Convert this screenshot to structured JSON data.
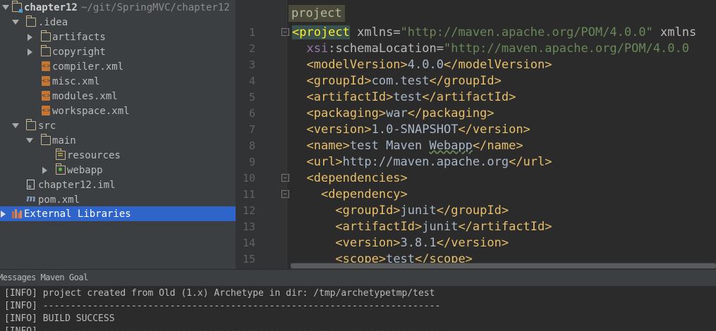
{
  "project_tree": {
    "root": {
      "name": "chapter12",
      "path": "~/git/SpringMVC/chapter12"
    },
    "items": [
      {
        "label": ".idea"
      },
      {
        "label": "artifacts"
      },
      {
        "label": "copyright"
      },
      {
        "label": "compiler.xml"
      },
      {
        "label": "misc.xml"
      },
      {
        "label": "modules.xml"
      },
      {
        "label": "workspace.xml"
      },
      {
        "label": "src"
      },
      {
        "label": "main"
      },
      {
        "label": "resources"
      },
      {
        "label": "webapp"
      },
      {
        "label": "chapter12.iml"
      },
      {
        "label": "pom.xml"
      },
      {
        "label": "External Libraries"
      }
    ],
    "maven_icon_glyph": "m"
  },
  "editor": {
    "breadcrumb": "project",
    "line_numbers": [
      "1",
      "2",
      "3",
      "4",
      "5",
      "6",
      "7",
      "8",
      "9",
      "10",
      "11",
      "12",
      "13",
      "14",
      "15"
    ],
    "lines": [
      [
        {
          "t": "<project",
          "c": "hl"
        },
        {
          "t": " xmlns",
          "c": "attr"
        },
        {
          "t": "=",
          "c": "attr"
        },
        {
          "t": "\"http://maven.apache.org/POM/4.0.0\"",
          "c": "val"
        },
        {
          "t": " xmlns",
          "c": "attr"
        }
      ],
      [
        {
          "t": "  "
        },
        {
          "t": "xsi",
          "c": "ns"
        },
        {
          "t": ":schemaLocation",
          "c": "attr"
        },
        {
          "t": "=",
          "c": "attr"
        },
        {
          "t": "\"http://maven.apache.org/POM/4.0.0",
          "c": "val"
        }
      ],
      [
        {
          "t": "  "
        },
        {
          "t": "<modelVersion>",
          "c": "tag"
        },
        {
          "t": "4.0.0",
          "c": "txt"
        },
        {
          "t": "</modelVersion>",
          "c": "tag"
        }
      ],
      [
        {
          "t": "  "
        },
        {
          "t": "<groupId>",
          "c": "tag"
        },
        {
          "t": "com.test",
          "c": "txt"
        },
        {
          "t": "</groupId>",
          "c": "tag"
        }
      ],
      [
        {
          "t": "  "
        },
        {
          "t": "<artifactId>",
          "c": "tag"
        },
        {
          "t": "test",
          "c": "txt"
        },
        {
          "t": "</artifactId>",
          "c": "tag"
        }
      ],
      [
        {
          "t": "  "
        },
        {
          "t": "<packaging>",
          "c": "tag"
        },
        {
          "t": "war",
          "c": "txt"
        },
        {
          "t": "</packaging>",
          "c": "tag"
        }
      ],
      [
        {
          "t": "  "
        },
        {
          "t": "<version>",
          "c": "tag"
        },
        {
          "t": "1.0-SNAPSHOT",
          "c": "txt"
        },
        {
          "t": "</version>",
          "c": "tag"
        }
      ],
      [
        {
          "t": "  "
        },
        {
          "t": "<name>",
          "c": "tag"
        },
        {
          "t": "test Maven ",
          "c": "txt"
        },
        {
          "t": "Webapp",
          "c": "txt underline"
        },
        {
          "t": "</name>",
          "c": "tag"
        }
      ],
      [
        {
          "t": "  "
        },
        {
          "t": "<url>",
          "c": "tag"
        },
        {
          "t": "http://maven.apache.org",
          "c": "txt"
        },
        {
          "t": "</url>",
          "c": "tag"
        }
      ],
      [
        {
          "t": "  "
        },
        {
          "t": "<dependencies>",
          "c": "tag"
        }
      ],
      [
        {
          "t": "    "
        },
        {
          "t": "<dependency>",
          "c": "tag"
        }
      ],
      [
        {
          "t": "      "
        },
        {
          "t": "<groupId>",
          "c": "tag"
        },
        {
          "t": "junit",
          "c": "txt"
        },
        {
          "t": "</groupId>",
          "c": "tag"
        }
      ],
      [
        {
          "t": "      "
        },
        {
          "t": "<artifactId>",
          "c": "tag"
        },
        {
          "t": "junit",
          "c": "txt"
        },
        {
          "t": "</artifactId>",
          "c": "tag"
        }
      ],
      [
        {
          "t": "      "
        },
        {
          "t": "<version>",
          "c": "tag"
        },
        {
          "t": "3.8.1",
          "c": "txt"
        },
        {
          "t": "</version>",
          "c": "tag"
        }
      ],
      [
        {
          "t": "      "
        },
        {
          "t": "<scope>",
          "c": "tag"
        },
        {
          "t": "test",
          "c": "txt"
        },
        {
          "t": "</scope>",
          "c": "tag"
        }
      ]
    ]
  },
  "tool_window": {
    "title": "Messages Maven Goal",
    "lines": [
      "[INFO] project created from Old (1.x) Archetype in dir: /tmp/archetypetmp/test",
      "[INFO] ------------------------------------------------------------------------",
      "[INFO] BUILD SUCCESS",
      "[INFO] ------------------------------------------------------------------------"
    ]
  },
  "colors": {
    "tag": "#e8bf6a",
    "attr": "#bababa",
    "value": "#6a8759",
    "namespace": "#9876aa",
    "text": "#a9b7c6",
    "selection": "#2f65ca",
    "panel": "#3c3f41",
    "editor_bg": "#2b2b2b"
  }
}
